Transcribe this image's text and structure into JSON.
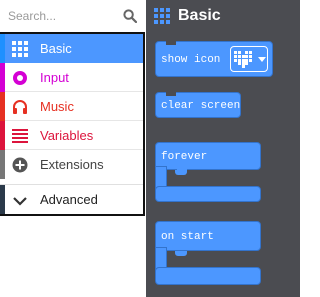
{
  "toolbox": {
    "search": {
      "placeholder": "Search..."
    },
    "categories": [
      {
        "label": "Basic",
        "icon": "grid-icon",
        "color": "#1e90ff",
        "selected": true
      },
      {
        "label": "Input",
        "icon": "radio-button-icon",
        "color": "#d400d4"
      },
      {
        "label": "Music",
        "icon": "headphones-icon",
        "color": "#e63022"
      },
      {
        "label": "Variables",
        "icon": "list-lines-icon",
        "color": "#dc143c"
      },
      {
        "label": "Extensions",
        "icon": "plus-circle-icon",
        "color": "#777777"
      }
    ],
    "advanced": {
      "label": "Advanced",
      "icon": "chevron-down-icon"
    }
  },
  "workspace": {
    "title": "Basic",
    "title_icon": "grid-icon",
    "background": "#4b4c51",
    "block_color": "#4c97ff",
    "blocks": [
      {
        "label": "show icon",
        "kind": "statement",
        "dropdown_icon": "heart-icon"
      },
      {
        "label": "clear screen",
        "kind": "statement"
      },
      {
        "label": "forever",
        "kind": "container"
      },
      {
        "label": "on start",
        "kind": "container"
      }
    ]
  }
}
